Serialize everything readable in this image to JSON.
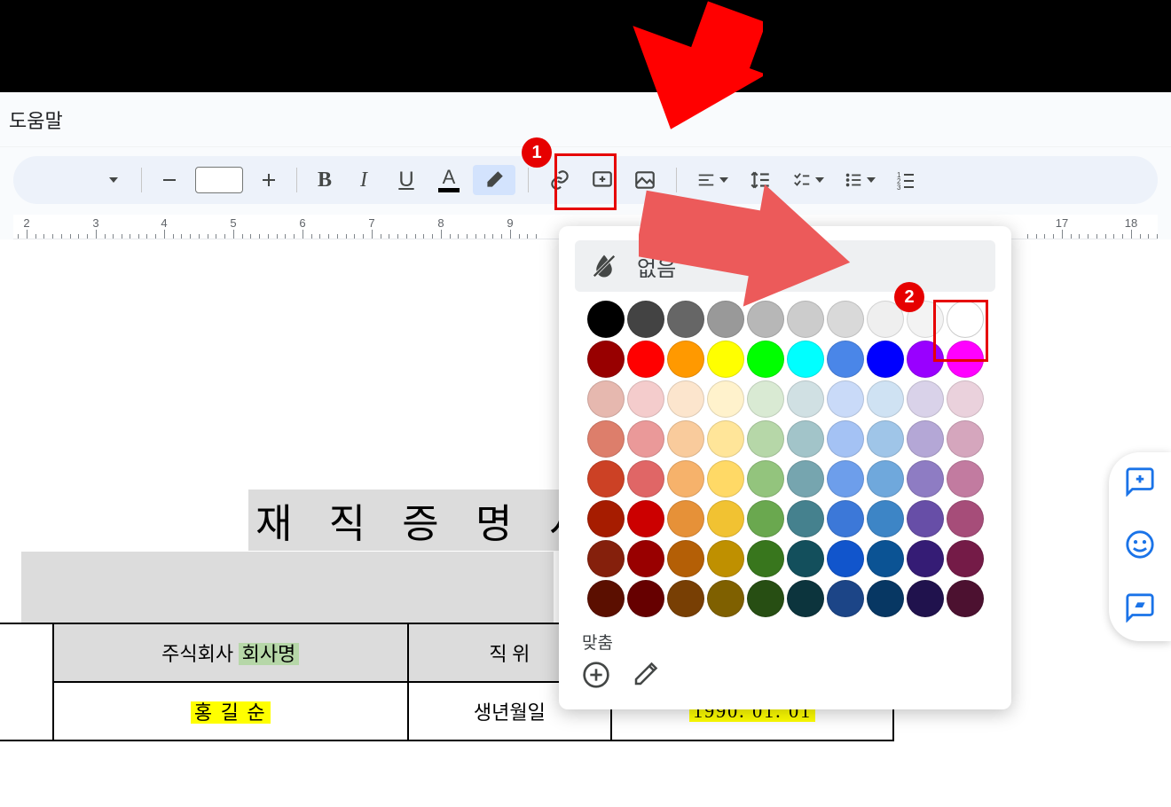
{
  "menu": {
    "help": "도움말"
  },
  "toolbar": {
    "highlight_active": true
  },
  "ruler": {
    "numbers": [
      2,
      3,
      4,
      5,
      6,
      7,
      8,
      9,
      17,
      18
    ]
  },
  "document": {
    "title": "재 직 증 명 서",
    "row1": {
      "c1": "주식회사 ",
      "c1_hl": "회사명",
      "c2": "직 위"
    },
    "row2": {
      "c1": "홍 길 순",
      "c2": "생년월일",
      "c3": "1990. 01. 01"
    }
  },
  "picker": {
    "none_label": "없음",
    "custom_label": "맞춤",
    "rows": [
      [
        "#000000",
        "#434343",
        "#666666",
        "#999999",
        "#b7b7b7",
        "#cccccc",
        "#d9d9d9",
        "#efefef",
        "#f3f3f3",
        "#ffffff"
      ],
      [
        "#980000",
        "#ff0000",
        "#ff9900",
        "#ffff00",
        "#00ff00",
        "#00ffff",
        "#4a86e8",
        "#0000ff",
        "#9900ff",
        "#ff00ff"
      ],
      [
        "#e6b8af",
        "#f4cccc",
        "#fce5cd",
        "#fff2cc",
        "#d9ead3",
        "#d0e0e3",
        "#c9daf8",
        "#cfe2f3",
        "#d9d2e9",
        "#ead1dc"
      ],
      [
        "#dd7e6b",
        "#ea9999",
        "#f9cb9c",
        "#ffe599",
        "#b6d7a8",
        "#a2c4c9",
        "#a4c2f4",
        "#9fc5e8",
        "#b4a7d6",
        "#d5a6bd"
      ],
      [
        "#cc4125",
        "#e06666",
        "#f6b26b",
        "#ffd966",
        "#93c47d",
        "#76a5af",
        "#6d9eeb",
        "#6fa8dc",
        "#8e7cc3",
        "#c27ba0"
      ],
      [
        "#a61c00",
        "#cc0000",
        "#e69138",
        "#f1c232",
        "#6aa84f",
        "#45818e",
        "#3c78d8",
        "#3d85c6",
        "#674ea7",
        "#a64d79"
      ],
      [
        "#85200c",
        "#990000",
        "#b45f06",
        "#bf9000",
        "#38761d",
        "#134f5c",
        "#1155cc",
        "#0b5394",
        "#351c75",
        "#741b47"
      ],
      [
        "#5b0f00",
        "#660000",
        "#783f04",
        "#7f6000",
        "#274e13",
        "#0c343d",
        "#1c4587",
        "#073763",
        "#20124d",
        "#4c1130"
      ]
    ]
  },
  "annotations": {
    "badge1": "1",
    "badge2": "2"
  }
}
